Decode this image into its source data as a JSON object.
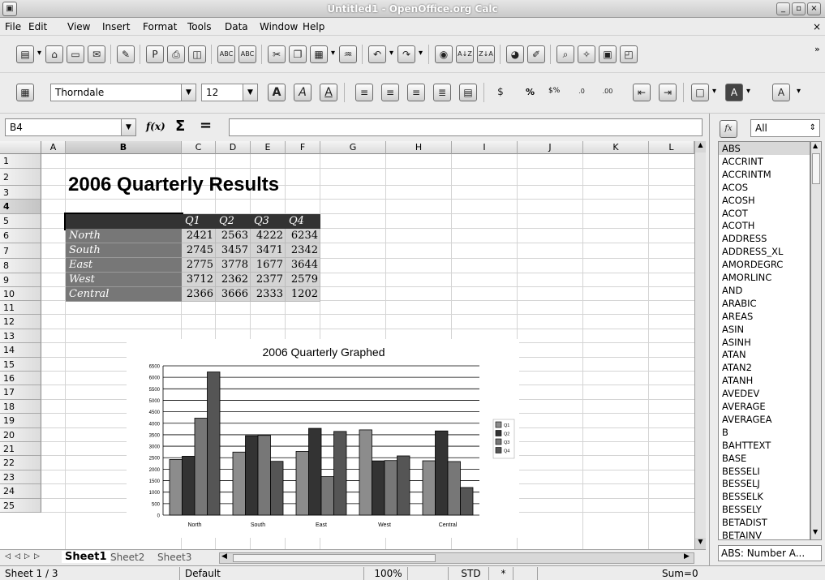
{
  "window": {
    "title": "Untitled1 - OpenOffice.org Calc",
    "min": "_",
    "max": "▫",
    "close": "×"
  },
  "menu": [
    "File",
    "Edit",
    "View",
    "Insert",
    "Format",
    "Tools",
    "Data",
    "Window",
    "Help"
  ],
  "menu_close": "×",
  "toolbar2": {
    "font_name": "Thorndale",
    "font_size": "12",
    "bold": "A",
    "italic": "A",
    "underline": "A",
    "percent": "%",
    "currency": "$%"
  },
  "formula_bar": {
    "name_box": "B4",
    "fx": "f(x)",
    "sum": "Σ",
    "equals": "=",
    "content": ""
  },
  "columns": [
    "A",
    "B",
    "C",
    "D",
    "E",
    "F",
    "G",
    "H",
    "I",
    "J",
    "K",
    "L"
  ],
  "rows": [
    "1",
    "2",
    "3",
    "4",
    "5",
    "6",
    "7",
    "8",
    "9",
    "10",
    "11",
    "12",
    "13",
    "14",
    "15",
    "16",
    "17",
    "18",
    "19",
    "20",
    "21",
    "22",
    "23",
    "24",
    "25"
  ],
  "sheet": {
    "title": "2006 Quarterly Results",
    "quarters": [
      "Q1",
      "Q2",
      "Q3",
      "Q4"
    ],
    "regions": [
      {
        "name": "North",
        "values": [
          "2421",
          "2563",
          "4222",
          "6234"
        ]
      },
      {
        "name": "South",
        "values": [
          "2745",
          "3457",
          "3471",
          "2342"
        ]
      },
      {
        "name": "East",
        "values": [
          "2775",
          "3778",
          "1677",
          "3644"
        ]
      },
      {
        "name": "West",
        "values": [
          "3712",
          "2362",
          "2377",
          "2579"
        ]
      },
      {
        "name": "Central",
        "values": [
          "2366",
          "3666",
          "2333",
          "1202"
        ]
      }
    ]
  },
  "chart_data": {
    "type": "bar",
    "title": "2006 Quarterly Graphed",
    "categories": [
      "North",
      "South",
      "East",
      "West",
      "Central"
    ],
    "series": [
      {
        "name": "Q1",
        "values": [
          2421,
          2745,
          2775,
          3712,
          2366
        ],
        "color": "#8c8c8c"
      },
      {
        "name": "Q2",
        "values": [
          2563,
          3457,
          3778,
          2362,
          3666
        ],
        "color": "#333333"
      },
      {
        "name": "Q3",
        "values": [
          4222,
          3471,
          1677,
          2377,
          2333
        ],
        "color": "#777777"
      },
      {
        "name": "Q4",
        "values": [
          6234,
          2342,
          3644,
          2579,
          1202
        ],
        "color": "#555555"
      }
    ],
    "yticks": [
      "6500",
      "6000",
      "5500",
      "5000",
      "4500",
      "4000",
      "3500",
      "3000",
      "2500",
      "2000",
      "1500",
      "1000",
      "500",
      "0"
    ],
    "ylim": [
      0,
      6500
    ],
    "grid": true,
    "legend": "right"
  },
  "sheet_tabs": [
    "Sheet1",
    "Sheet2",
    "Sheet3"
  ],
  "status": {
    "sheet": "Sheet 1 / 3",
    "style": "Default",
    "zoom": "100%",
    "mode": "STD",
    "modified": "*",
    "sum": "Sum=0"
  },
  "functions_panel": {
    "fx": "fx",
    "category": "All",
    "items": [
      "ABS",
      "ACCRINT",
      "ACCRINTM",
      "ACOS",
      "ACOSH",
      "ACOT",
      "ACOTH",
      "ADDRESS",
      "ADDRESS_XL",
      "AMORDEGRC",
      "AMORLINC",
      "AND",
      "ARABIC",
      "AREAS",
      "ASIN",
      "ASINH",
      "ATAN",
      "ATAN2",
      "ATANH",
      "AVEDEV",
      "AVERAGE",
      "AVERAGEA",
      "B",
      "BAHTTEXT",
      "BASE",
      "BESSELI",
      "BESSELJ",
      "BESSELK",
      "BESSELY",
      "BETADIST",
      "BETAINV"
    ],
    "description": "ABS: Number A..."
  },
  "colors": {
    "header_dark": "#333333",
    "region_fill": "#777777",
    "value_fill": "#d4d4d4"
  }
}
